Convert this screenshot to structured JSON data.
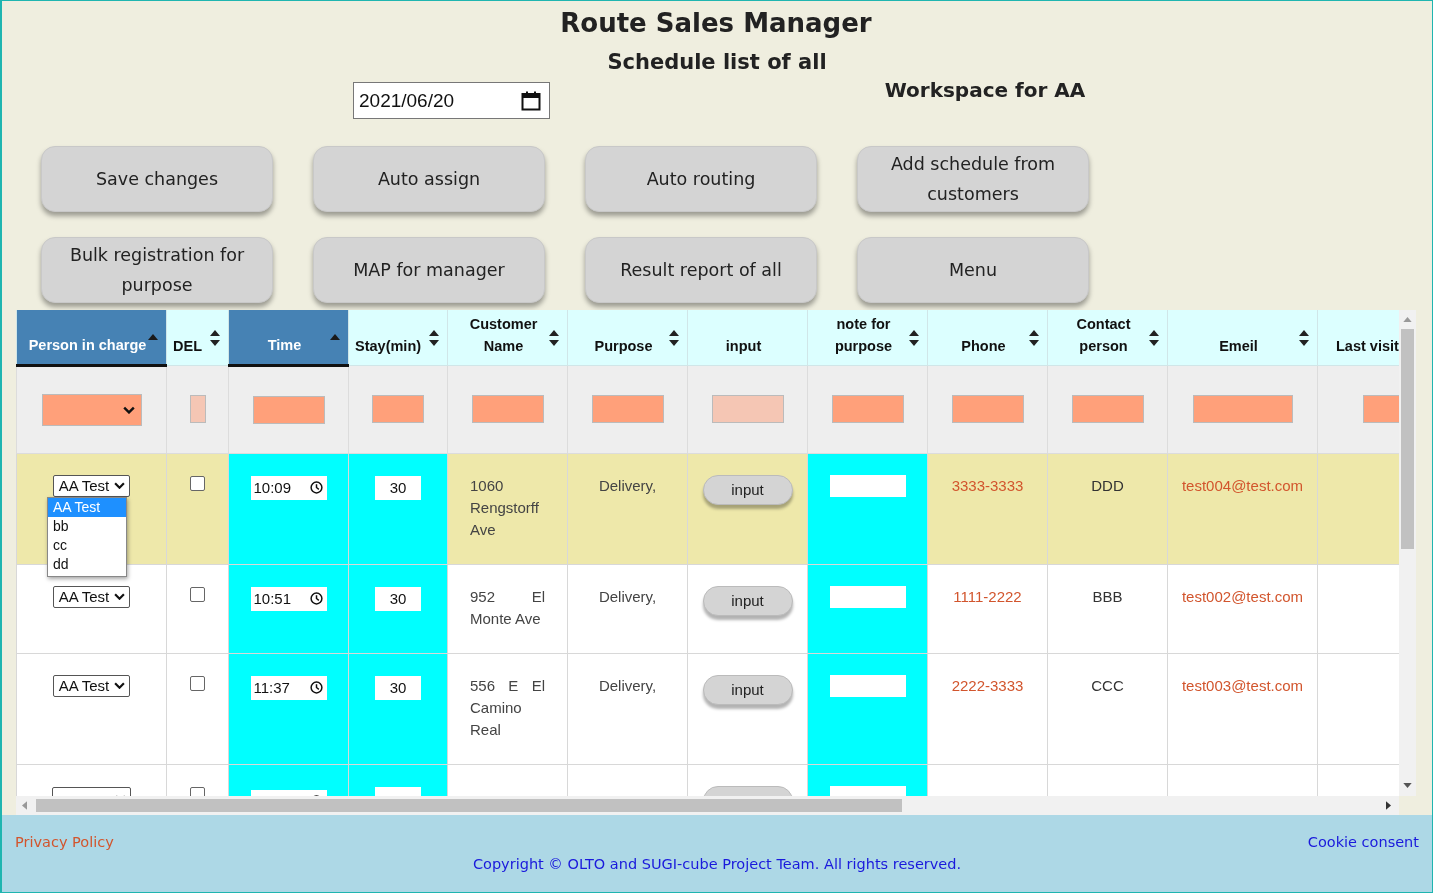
{
  "title": "Route Sales Manager",
  "subtitle": "Schedule list of all",
  "date_field": {
    "value": "2021/06/20"
  },
  "workspace": "Workspace for AA",
  "buttons": [
    "Save changes",
    "Auto assign",
    "Auto routing",
    "Add schedule from customers",
    "Bulk registration for purpose",
    "MAP for manager",
    "Result report of all",
    "Menu"
  ],
  "table": {
    "columns": [
      {
        "label": "Person in charge",
        "sorted": true,
        "accent": false
      },
      {
        "label": "DEL",
        "sorted": false,
        "accent": false
      },
      {
        "label": "Time",
        "sorted": true,
        "accent": true
      },
      {
        "label": "Stay(min)",
        "sorted": false,
        "accent": true
      },
      {
        "label": "Customer Name",
        "sorted": false,
        "accent": false
      },
      {
        "label": "Purpose",
        "sorted": false,
        "accent": false
      },
      {
        "label": "input",
        "sorted": false,
        "accent": false,
        "unsortable": true
      },
      {
        "label": "note for purpose",
        "sorted": false,
        "accent": true
      },
      {
        "label": "Phone",
        "sorted": false,
        "accent": false
      },
      {
        "label": "Contact person",
        "sorted": false,
        "accent": false
      },
      {
        "label": "Emeil",
        "sorted": false,
        "accent": false
      },
      {
        "label": "Last visit",
        "sorted": false,
        "accent": false,
        "unsortable": true
      }
    ],
    "filters": [
      {
        "kind": "select",
        "disabled": false
      },
      {
        "kind": "checkbox",
        "disabled": true,
        "checked": false
      },
      {
        "kind": "text",
        "disabled": false
      },
      {
        "kind": "text",
        "disabled": false
      },
      {
        "kind": "text",
        "disabled": false
      },
      {
        "kind": "text",
        "disabled": false
      },
      {
        "kind": "text",
        "disabled": true
      },
      {
        "kind": "text",
        "disabled": false
      },
      {
        "kind": "text",
        "disabled": false
      },
      {
        "kind": "text",
        "disabled": false
      },
      {
        "kind": "text",
        "disabled": false
      },
      {
        "kind": "text",
        "disabled": false
      }
    ],
    "rows": [
      {
        "highlighted": true,
        "cells": [
          {
            "kind": "select",
            "value": "AA Test",
            "open": true,
            "options": [
              {
                "label": "AA Test",
                "selected": true
              },
              {
                "label": "bb",
                "selected": false
              },
              {
                "label": "cc",
                "selected": false
              },
              {
                "label": "dd",
                "selected": false
              }
            ]
          },
          {
            "kind": "checkbox",
            "checked": false
          },
          {
            "kind": "time",
            "value": "10:09"
          },
          {
            "kind": "number",
            "value": "30"
          },
          {
            "kind": "address",
            "value": "1060 Rengstorff Ave"
          },
          {
            "kind": "text",
            "value": "Delivery,"
          },
          {
            "kind": "button",
            "label": "input"
          },
          {
            "kind": "field"
          },
          {
            "kind": "link",
            "value": "3333-3333"
          },
          {
            "kind": "text",
            "value": "DDD"
          },
          {
            "kind": "link",
            "value": "test004@test.com"
          },
          {
            "kind": "empty"
          }
        ]
      },
      {
        "highlighted": false,
        "cells": [
          {
            "kind": "select",
            "value": "AA Test"
          },
          {
            "kind": "checkbox",
            "checked": false
          },
          {
            "kind": "time",
            "value": "10:51"
          },
          {
            "kind": "number",
            "value": "30"
          },
          {
            "kind": "address",
            "value": "952 El Monte Ave"
          },
          {
            "kind": "text",
            "value": "Delivery,"
          },
          {
            "kind": "button",
            "label": "input"
          },
          {
            "kind": "field"
          },
          {
            "kind": "link",
            "value": "1111-2222"
          },
          {
            "kind": "text",
            "value": "BBB"
          },
          {
            "kind": "link",
            "value": "test002@test.com"
          },
          {
            "kind": "empty"
          }
        ]
      },
      {
        "highlighted": false,
        "cells": [
          {
            "kind": "select",
            "value": "AA Test"
          },
          {
            "kind": "checkbox",
            "checked": false
          },
          {
            "kind": "time",
            "value": "11:37"
          },
          {
            "kind": "number",
            "value": "30"
          },
          {
            "kind": "address",
            "value": "556 E El Camino Real"
          },
          {
            "kind": "text",
            "value": "Delivery,"
          },
          {
            "kind": "button",
            "label": "input"
          },
          {
            "kind": "field"
          },
          {
            "kind": "link",
            "value": "2222-3333"
          },
          {
            "kind": "text",
            "value": "CCC"
          },
          {
            "kind": "link",
            "value": "test003@test.com"
          },
          {
            "kind": "empty"
          }
        ]
      },
      {
        "highlighted": false,
        "cells": [
          {
            "kind": "select"
          },
          {
            "kind": "checkbox",
            "checked": false
          },
          {
            "kind": "time"
          },
          {
            "kind": "number"
          },
          {
            "kind": "address"
          },
          {
            "kind": "text"
          },
          {
            "kind": "button"
          },
          {
            "kind": "field"
          },
          {
            "kind": "link"
          },
          {
            "kind": "text"
          },
          {
            "kind": "link"
          },
          {
            "kind": "empty"
          }
        ]
      }
    ]
  },
  "footer": {
    "privacy": "Privacy Policy",
    "cookie": "Cookie consent",
    "copyright": "Copyright © OLTO and SUGI-cube Project Team. All rights reserved."
  }
}
